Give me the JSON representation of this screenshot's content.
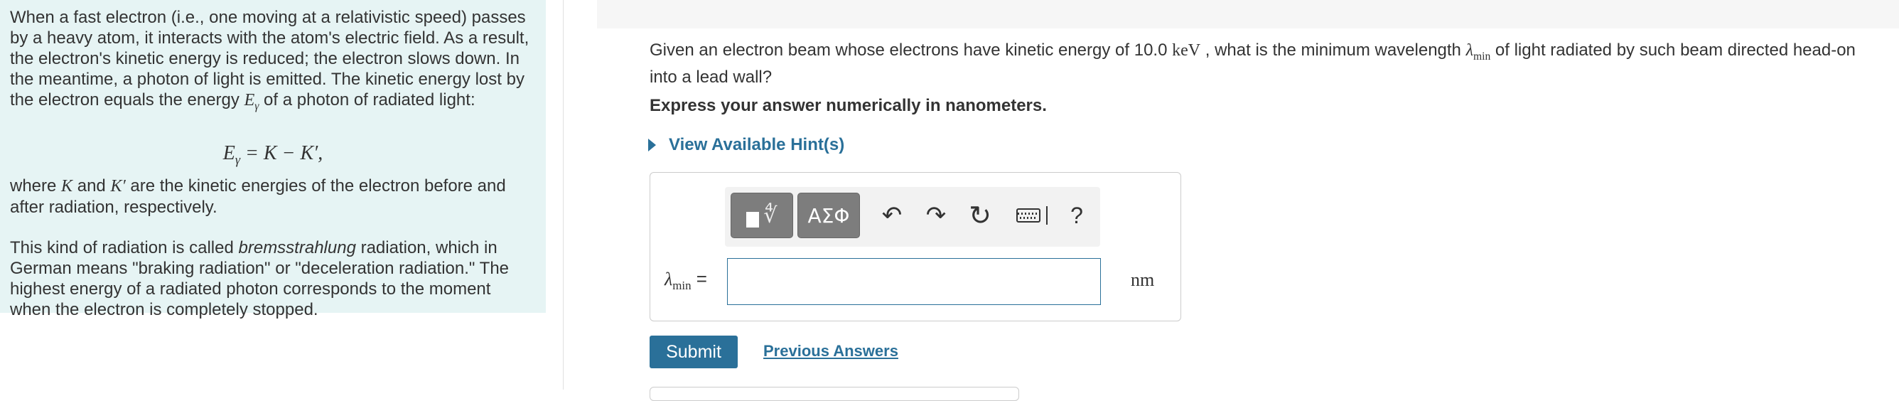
{
  "intro": {
    "p1_a": "When a fast electron (i.e., one moving at a relativistic speed) passes by a heavy atom, it interacts with the atom's electric field. As a result, the electron's kinetic energy is reduced; the electron slows down. In the meantime, a photon of light is emitted. The kinetic energy lost by the electron equals the energy ",
    "p1_sym": "E",
    "p1_sub": "γ",
    "p1_b": " of a photon of radiated light:",
    "eq_lhs": "E",
    "eq_lhs_sub": "γ",
    "eq_rhs": " = K − K′,",
    "p2_a": "where ",
    "p2_K": "K",
    "p2_and": " and ",
    "p2_Kp": "K′",
    "p2_b": " are the kinetic energies of the electron before and after radiation, respectively.",
    "p3_a": "This kind of radiation is called ",
    "p3_term": "bremsstrahlung",
    "p3_b": " radiation, which in German means \"braking radiation\" or \"deceleration radiation.\" The highest energy of a radiated photon corresponds to the moment when the electron is completely stopped."
  },
  "question": {
    "text_a": "Given an electron beam whose electrons have kinetic energy of 10.0 ",
    "unit_kev": "keV",
    "text_b": " , what is the minimum wavelength ",
    "lambda": "λ",
    "lambda_sub": "min",
    "text_c": " of light radiated by such beam directed head-on into a lead wall?",
    "instruction": "Express your answer numerically in nanometers.",
    "hints_label": "View Available Hint(s)"
  },
  "toolbar": {
    "templates_icon": "templates-icon",
    "symbols_label": "ΑΣΦ",
    "undo_glyph": "↶",
    "redo_glyph": "↷",
    "reset_glyph": "↻",
    "help_label": "?"
  },
  "answer": {
    "label_sym": "λ",
    "label_sub": "min",
    "label_eq": " =",
    "value": "",
    "unit": "nm"
  },
  "actions": {
    "submit_label": "Submit",
    "previous_answers_label": "Previous Answers"
  },
  "colors": {
    "accent": "#2a7099",
    "intro_bg": "#e6f4f4"
  }
}
